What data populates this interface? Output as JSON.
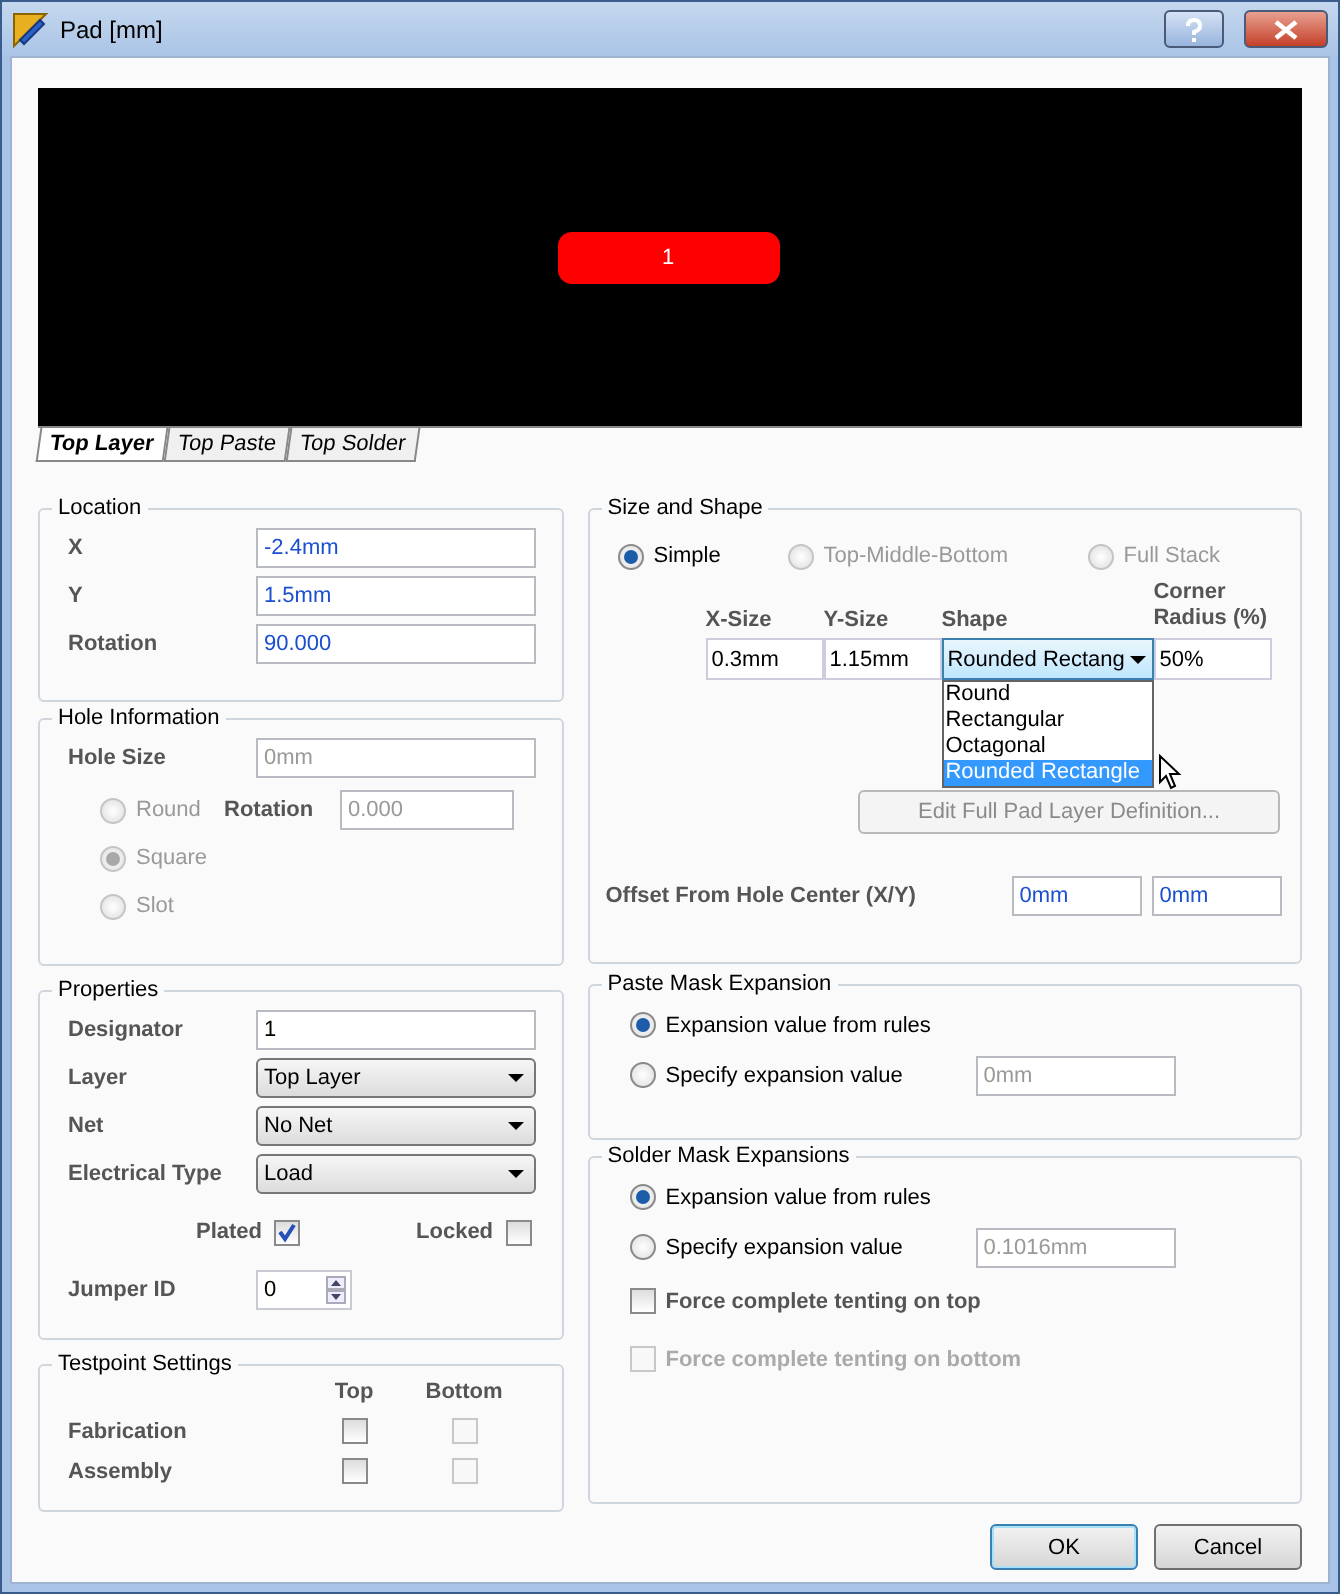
{
  "window": {
    "title": "Pad [mm]"
  },
  "preview": {
    "pad_label": "1"
  },
  "layer_tabs": [
    {
      "label": "Top Layer",
      "selected": true
    },
    {
      "label": "Top Paste",
      "selected": false
    },
    {
      "label": "Top Solder",
      "selected": false
    }
  ],
  "location": {
    "title": "Location",
    "fields": [
      {
        "label": "X",
        "value": "-2.4mm"
      },
      {
        "label": "Y",
        "value": "1.5mm"
      },
      {
        "label": "Rotation",
        "value": "90.000"
      }
    ]
  },
  "hole_information": {
    "title": "Hole Information",
    "disabled": true,
    "hole_size": {
      "label": "Hole Size",
      "value": "0mm"
    },
    "rotation": {
      "label": "Rotation",
      "value": "0.000"
    },
    "shapes": [
      {
        "label": "Round",
        "selected": false
      },
      {
        "label": "Square",
        "selected": true
      },
      {
        "label": "Slot",
        "selected": false
      }
    ]
  },
  "properties": {
    "title": "Properties",
    "designator": {
      "label": "Designator",
      "value": "1"
    },
    "dropdowns": [
      {
        "label": "Layer",
        "value": "Top Layer"
      },
      {
        "label": "Net",
        "value": "No Net"
      },
      {
        "label": "Electrical Type",
        "value": "Load"
      }
    ],
    "checks": [
      {
        "label": "Plated",
        "checked": true
      },
      {
        "label": "Locked",
        "checked": false
      }
    ],
    "jumper_id": {
      "label": "Jumper ID",
      "value": "0"
    }
  },
  "testpoint_settings": {
    "title": "Testpoint Settings",
    "columns": [
      "Top",
      "Bottom"
    ],
    "rows": [
      {
        "label": "Fabrication",
        "top": {
          "checked": false,
          "disabled": false
        },
        "bottom": {
          "checked": false,
          "disabled": true
        }
      },
      {
        "label": "Assembly",
        "top": {
          "checked": false,
          "disabled": false
        },
        "bottom": {
          "checked": false,
          "disabled": true
        }
      }
    ]
  },
  "size_and_shape": {
    "title": "Size and Shape",
    "modes": [
      {
        "label": "Simple",
        "selected": true,
        "disabled": false
      },
      {
        "label": "Top-Middle-Bottom",
        "selected": false,
        "disabled": true
      },
      {
        "label": "Full Stack",
        "selected": false,
        "disabled": true
      }
    ],
    "x_size": {
      "label": "X-Size",
      "value": "0.3mm"
    },
    "y_size": {
      "label": "Y-Size",
      "value": "1.15mm"
    },
    "shape": {
      "label": "Shape",
      "value": "Rounded Rectang",
      "expanded": true,
      "options": [
        {
          "label": "Round",
          "selected": false
        },
        {
          "label": "Rectangular",
          "selected": false
        },
        {
          "label": "Octagonal",
          "selected": false
        },
        {
          "label": "Rounded Rectangle",
          "selected": true
        }
      ]
    },
    "corner_radius": {
      "label": "Corner Radius (%)",
      "value": "50%"
    },
    "edit_button": {
      "label": "Edit Full Pad Layer Definition...",
      "disabled": true
    },
    "offset": {
      "label": "Offset From Hole Center (X/Y)",
      "x": "0mm",
      "y": "0mm"
    }
  },
  "paste_mask_expansion": {
    "title": "Paste Mask Expansion",
    "options": [
      {
        "label": "Expansion value from rules",
        "selected": true
      },
      {
        "label": "Specify expansion value",
        "selected": false
      }
    ],
    "value": "0mm"
  },
  "solder_mask_expansions": {
    "title": "Solder Mask Expansions",
    "options": [
      {
        "label": "Expansion value from rules",
        "selected": true
      },
      {
        "label": "Specify expansion value",
        "selected": false
      }
    ],
    "value": "0.1016mm",
    "tenting": [
      {
        "label": "Force complete tenting on top",
        "checked": false,
        "disabled": false
      },
      {
        "label": "Force complete tenting on bottom",
        "checked": false,
        "disabled": true
      }
    ]
  },
  "buttons": [
    {
      "label": "OK",
      "default": true
    },
    {
      "label": "Cancel",
      "default": false
    }
  ]
}
